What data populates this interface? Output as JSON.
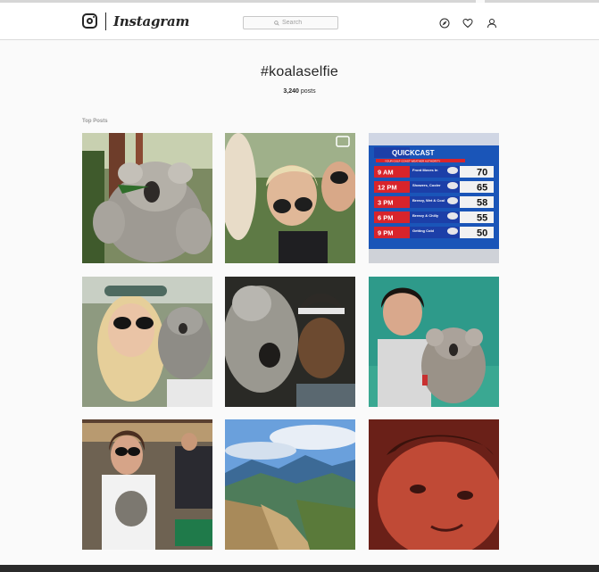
{
  "nav": {
    "brand": "Instagram",
    "search_placeholder": "Search",
    "icons": [
      "instagram-glyph-icon",
      "compass-icon",
      "heart-icon",
      "person-icon"
    ]
  },
  "tag": {
    "title": "#koalaselfie",
    "post_count": "3,240",
    "post_count_suffix": " posts"
  },
  "section": {
    "top_posts_label": "Top Posts"
  },
  "weather": {
    "title": "QUICKCAST",
    "subtitle": "YOUR GULF COAST WEATHER AUTHORITY",
    "rows": [
      {
        "time": "9 AM",
        "desc": "Front Moves In",
        "temp": "70"
      },
      {
        "time": "12 PM",
        "desc": "Showers, Cooler",
        "temp": "65"
      },
      {
        "time": "3 PM",
        "desc": "Breezy, Wet & Cool",
        "temp": "58"
      },
      {
        "time": "6 PM",
        "desc": "Breezy & Chilly",
        "temp": "55"
      },
      {
        "time": "9 PM",
        "desc": "Getting Cold",
        "temp": "50"
      }
    ]
  },
  "colors": {
    "accent_text": "#262626",
    "border": "#dbdbdb",
    "weather_blue": "#1c3fa8",
    "weather_red": "#d8242b"
  }
}
